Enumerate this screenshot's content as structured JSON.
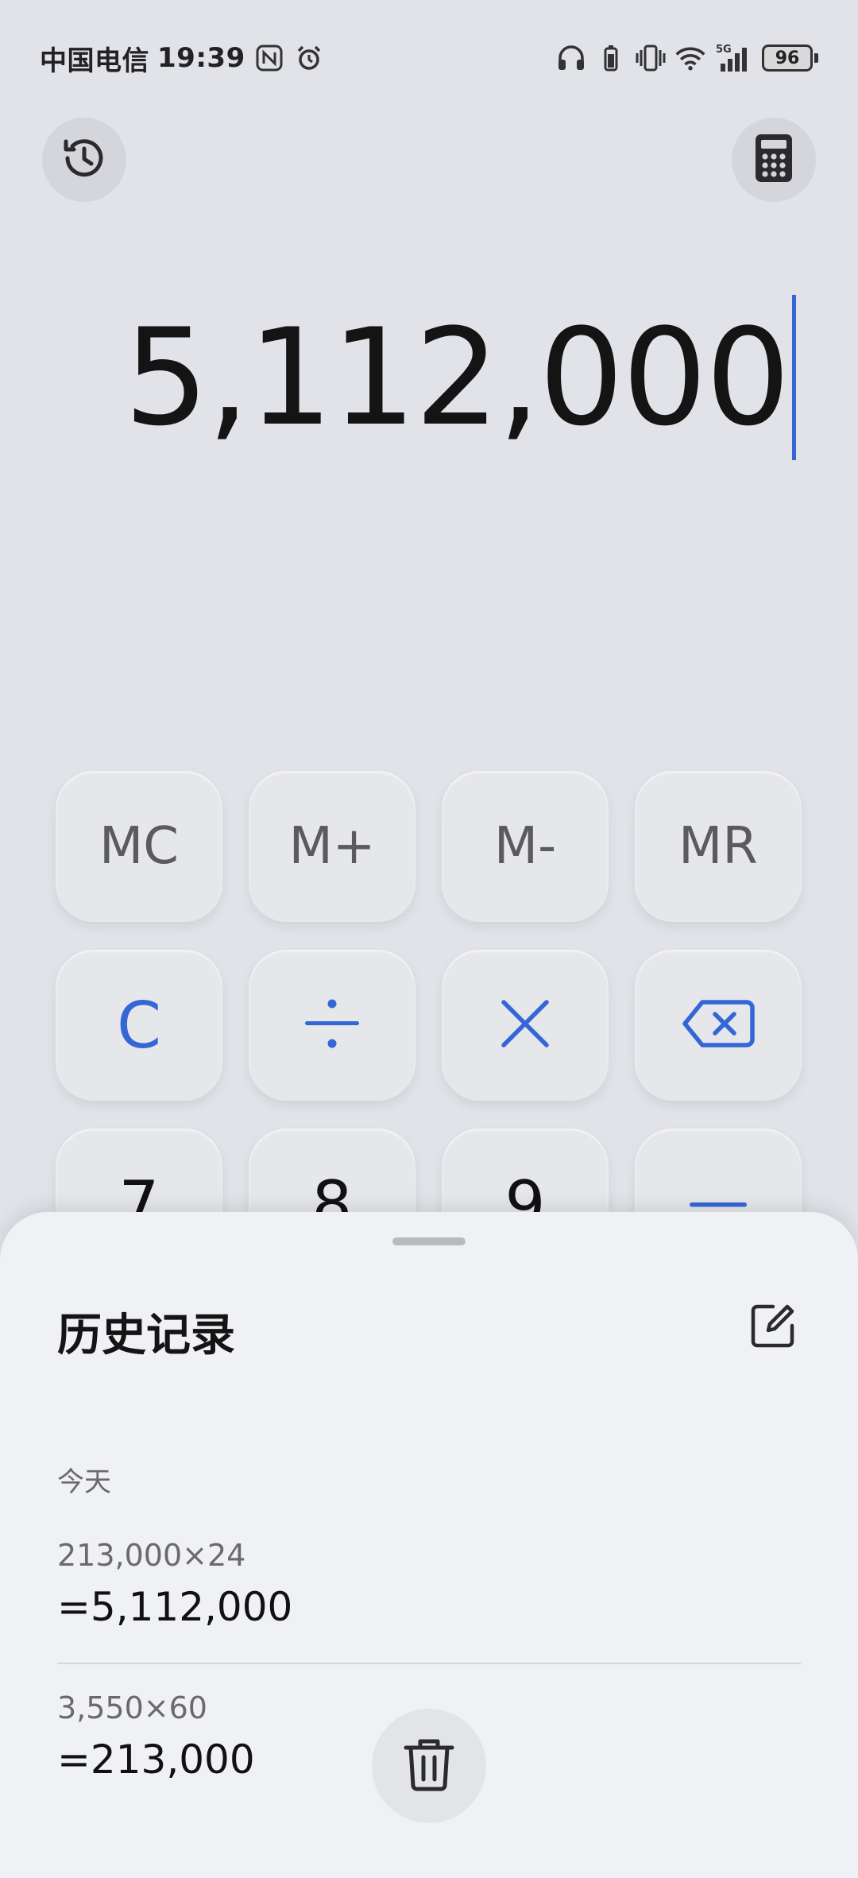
{
  "status_bar": {
    "carrier": "中国电信",
    "time": "19:39",
    "battery": "96",
    "network": "5G"
  },
  "display": {
    "value": "5,112,000"
  },
  "keypad": {
    "row1": [
      "MC",
      "M+",
      "M-",
      "MR"
    ],
    "row2": [
      "C",
      "÷",
      "×",
      "⌫"
    ],
    "row3": [
      "7",
      "8",
      "9",
      "−"
    ]
  },
  "history": {
    "title": "历史记录",
    "section": "今天",
    "entries": [
      {
        "expression": "213,000×24",
        "result": "=5,112,000"
      },
      {
        "expression": "3,550×60",
        "result": "=213,000"
      }
    ]
  },
  "colors": {
    "accent": "#3566d6",
    "background": "#e2e3e8",
    "sheet": "#f0f1f5"
  },
  "icons": [
    "history-icon",
    "calculator-icon",
    "edit-icon",
    "trash-icon",
    "backspace-icon",
    "nfc-icon",
    "alarm-icon",
    "headphones-icon",
    "vibrate-icon",
    "wifi-icon",
    "signal-icon"
  ]
}
